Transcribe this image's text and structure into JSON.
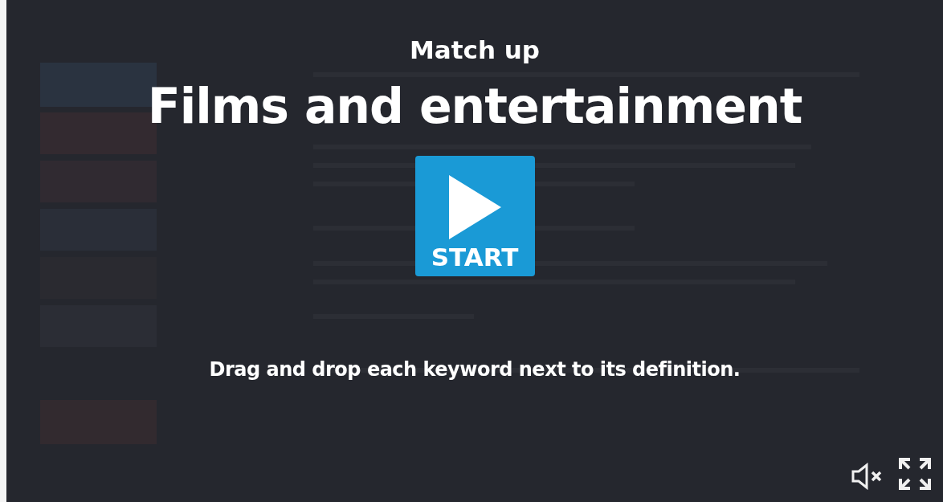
{
  "activity_type": "Match up",
  "title": "Films and entertainment",
  "start_button": {
    "label": "START"
  },
  "instruction": "Drag and drop each keyword next to its definition.",
  "sound": {
    "muted": true
  }
}
